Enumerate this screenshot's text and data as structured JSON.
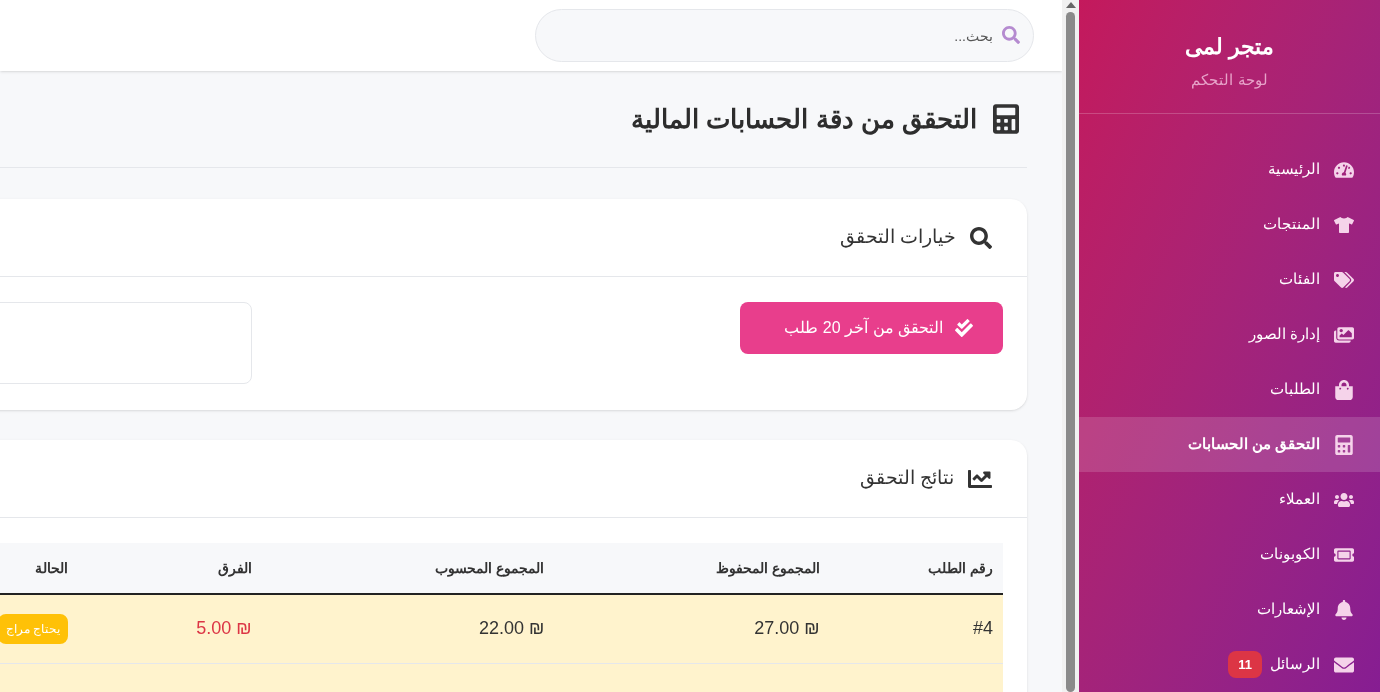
{
  "sidebar": {
    "title": "متجر لمى",
    "subtitle": "لوحة التحكم",
    "items": [
      {
        "label": "الرئيسية",
        "selected": false
      },
      {
        "label": "المنتجات",
        "selected": false
      },
      {
        "label": "الفئات",
        "selected": false
      },
      {
        "label": "إدارة الصور",
        "selected": false
      },
      {
        "label": "الطلبات",
        "selected": false
      },
      {
        "label": "التحقق من الحسابات",
        "selected": true
      },
      {
        "label": "العملاء",
        "selected": false
      },
      {
        "label": "الكوبونات",
        "selected": false
      },
      {
        "label": "الإشعارات",
        "selected": false
      },
      {
        "label": "الرسائل",
        "selected": false,
        "badge": "11"
      }
    ]
  },
  "search": {
    "placeholder": "بحث..."
  },
  "page_title": "التحقق من دقة الحسابات المالية",
  "options_card": {
    "title": "خيارات التحقق",
    "button": "التحقق من آخر 20 طلب"
  },
  "results_card": {
    "title": "نتائج التحقق",
    "table": {
      "columns": [
        "رقم الطلب",
        "المجموع المحفوظ",
        "المجموع المحسوب",
        "الفرق",
        "الحالة"
      ],
      "rows": [
        {
          "order": "#4",
          "saved": "27.00 ₪",
          "computed": "22.00 ₪",
          "difference": "5.00 ₪",
          "status": "يحتاج مراج",
          "mismatch": true
        }
      ]
    }
  }
}
